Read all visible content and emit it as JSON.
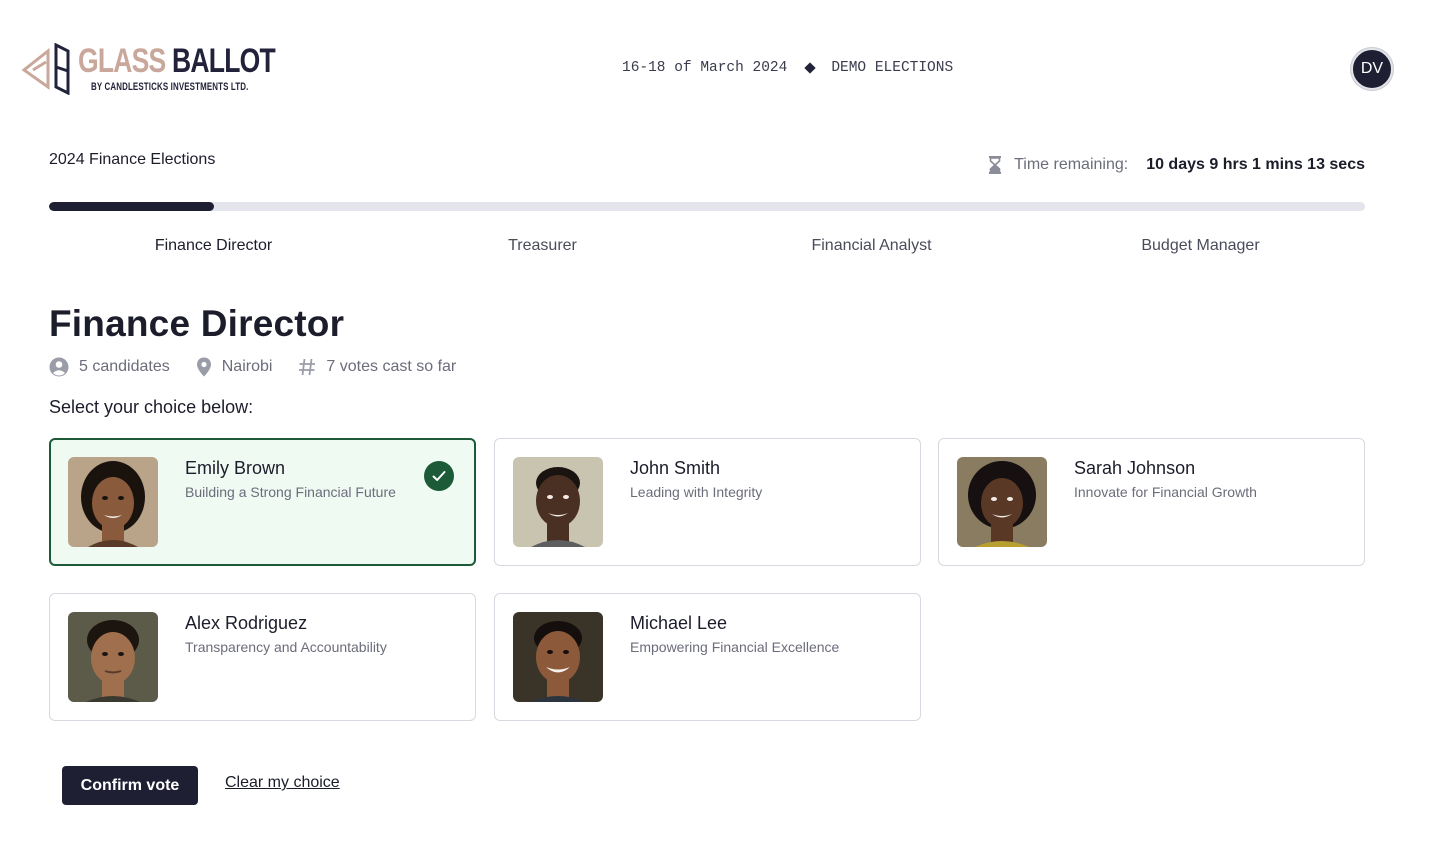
{
  "brand": {
    "name_part1": "GLASS",
    "name_part2": "BALLOT",
    "tagline": "BY CANDLESTICKS INVESTMENTS LTD.",
    "colors": {
      "primary": "#22233a",
      "accent": "#c9a79a"
    }
  },
  "header": {
    "dates": "16-18 of March 2024",
    "event": "DEMO ELECTIONS",
    "user_initials": "DV"
  },
  "election": {
    "title": "2024 Finance Elections",
    "time_label": "Time remaining:",
    "time_value": "10 days 9 hrs 1 mins 13 secs",
    "progress_fraction": 0.125,
    "steps": [
      "Finance Director",
      "Treasurer",
      "Financial Analyst",
      "Budget Manager"
    ],
    "active_step": 0
  },
  "position": {
    "title": "Finance Director",
    "candidates_count": "5 candidates",
    "location": "Nairobi",
    "votes_cast": "7 votes cast so far",
    "prompt": "Select your choice below:"
  },
  "candidates": [
    {
      "name": "Emily Brown",
      "tagline": "Building a Strong Financial Future",
      "selected": true,
      "skin": "#8a5a3c",
      "hair": "#1a120d",
      "bg": "#b9a48a"
    },
    {
      "name": "John Smith",
      "tagline": "Leading with Integrity",
      "selected": false,
      "skin": "#4a3022",
      "hair": "#1a1410",
      "bg": "#c9c4b0"
    },
    {
      "name": "Sarah Johnson",
      "tagline": "Innovate for Financial Growth",
      "selected": false,
      "skin": "#5a3826",
      "hair": "#161010",
      "bg": "#8a7c60"
    },
    {
      "name": "Alex Rodriguez",
      "tagline": "Transparency and Accountability",
      "selected": false,
      "skin": "#a0704e",
      "hair": "#1c140f",
      "bg": "#5c5a48"
    },
    {
      "name": "Michael Lee",
      "tagline": "Empowering Financial Excellence",
      "selected": false,
      "skin": "#8c5a3a",
      "hair": "#140f0c",
      "bg": "#3a3428"
    }
  ],
  "actions": {
    "confirm_label": "Confirm vote",
    "clear_label": "Clear my choice"
  },
  "status_colors": {
    "selected_border": "#1d5a37",
    "selected_bg": "#effaf3"
  }
}
